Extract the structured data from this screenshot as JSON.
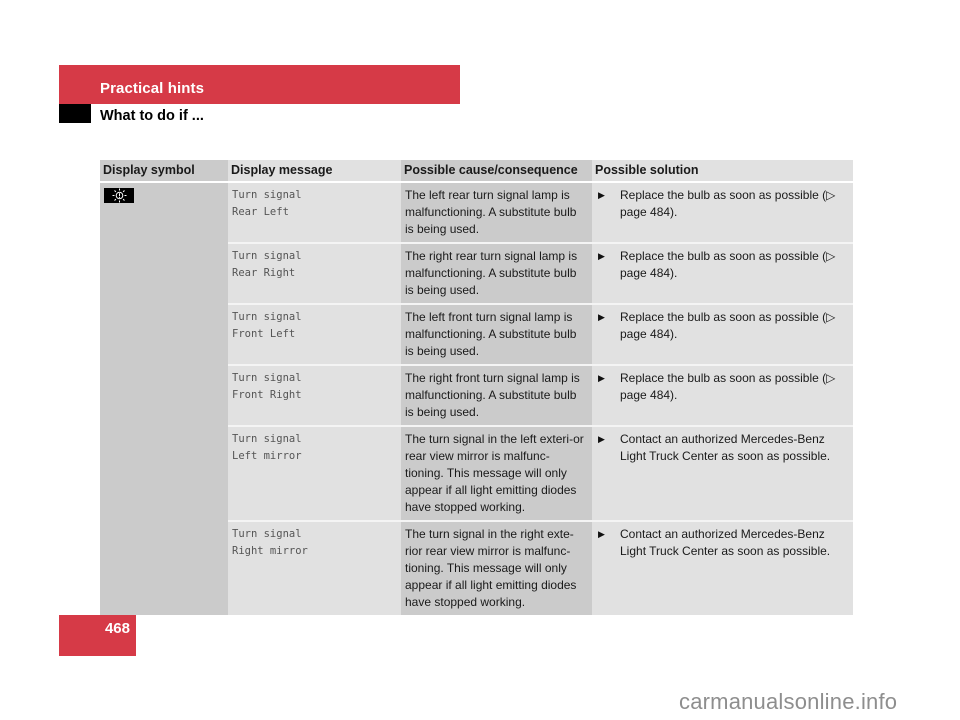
{
  "header": {
    "section_title": "Practical hints",
    "subsection_title": "What to do if ..."
  },
  "table": {
    "columns": [
      "Display symbol",
      "Display message",
      "Possible cause/consequence",
      "Possible solution"
    ],
    "symbol_icon": "bulb-failure-icon",
    "rows": [
      {
        "message": [
          "Turn signal",
          "Rear Left"
        ],
        "cause": "The left rear turn signal lamp is malfunctioning. A substitute bulb is being used.",
        "solution": "Replace the bulb as soon as possible (▷ page 484)."
      },
      {
        "message": [
          "Turn signal",
          "Rear Right"
        ],
        "cause": "The right rear turn signal lamp is malfunctioning. A substitute bulb is being used.",
        "solution": "Replace the bulb as soon as possible (▷ page 484)."
      },
      {
        "message": [
          "Turn signal",
          "Front Left"
        ],
        "cause": "The left front turn signal lamp is malfunctioning. A substitute bulb is being used.",
        "solution": "Replace the bulb as soon as possible (▷ page 484)."
      },
      {
        "message": [
          "Turn signal",
          "Front Right"
        ],
        "cause": "The right front turn signal lamp is malfunctioning. A substitute bulb is being used.",
        "solution": "Replace the bulb as soon as possible (▷ page 484)."
      },
      {
        "message": [
          "Turn signal",
          "Left mirror"
        ],
        "cause": "The turn signal in the left exteri-or rear view mirror is malfunc-tioning. This message will only appear if all light emitting diodes have stopped working.",
        "solution": "Contact an authorized Mercedes-Benz Light Truck Center as soon as possible."
      },
      {
        "message": [
          "Turn signal",
          "Right mirror"
        ],
        "cause": "The turn signal in the right exte-rior rear view mirror is malfunc-tioning. This message will only appear if all light emitting diodes have stopped working.",
        "solution": "Contact an authorized Mercedes-Benz Light Truck Center as soon as possible."
      }
    ],
    "bullet_glyph": "▶"
  },
  "footer": {
    "page_number": "468",
    "watermark": "carmanualsonline.info"
  },
  "colors": {
    "accent_red": "#d63a47",
    "dark_column": "#cbcbcb",
    "light_column": "#e1e1e1"
  }
}
